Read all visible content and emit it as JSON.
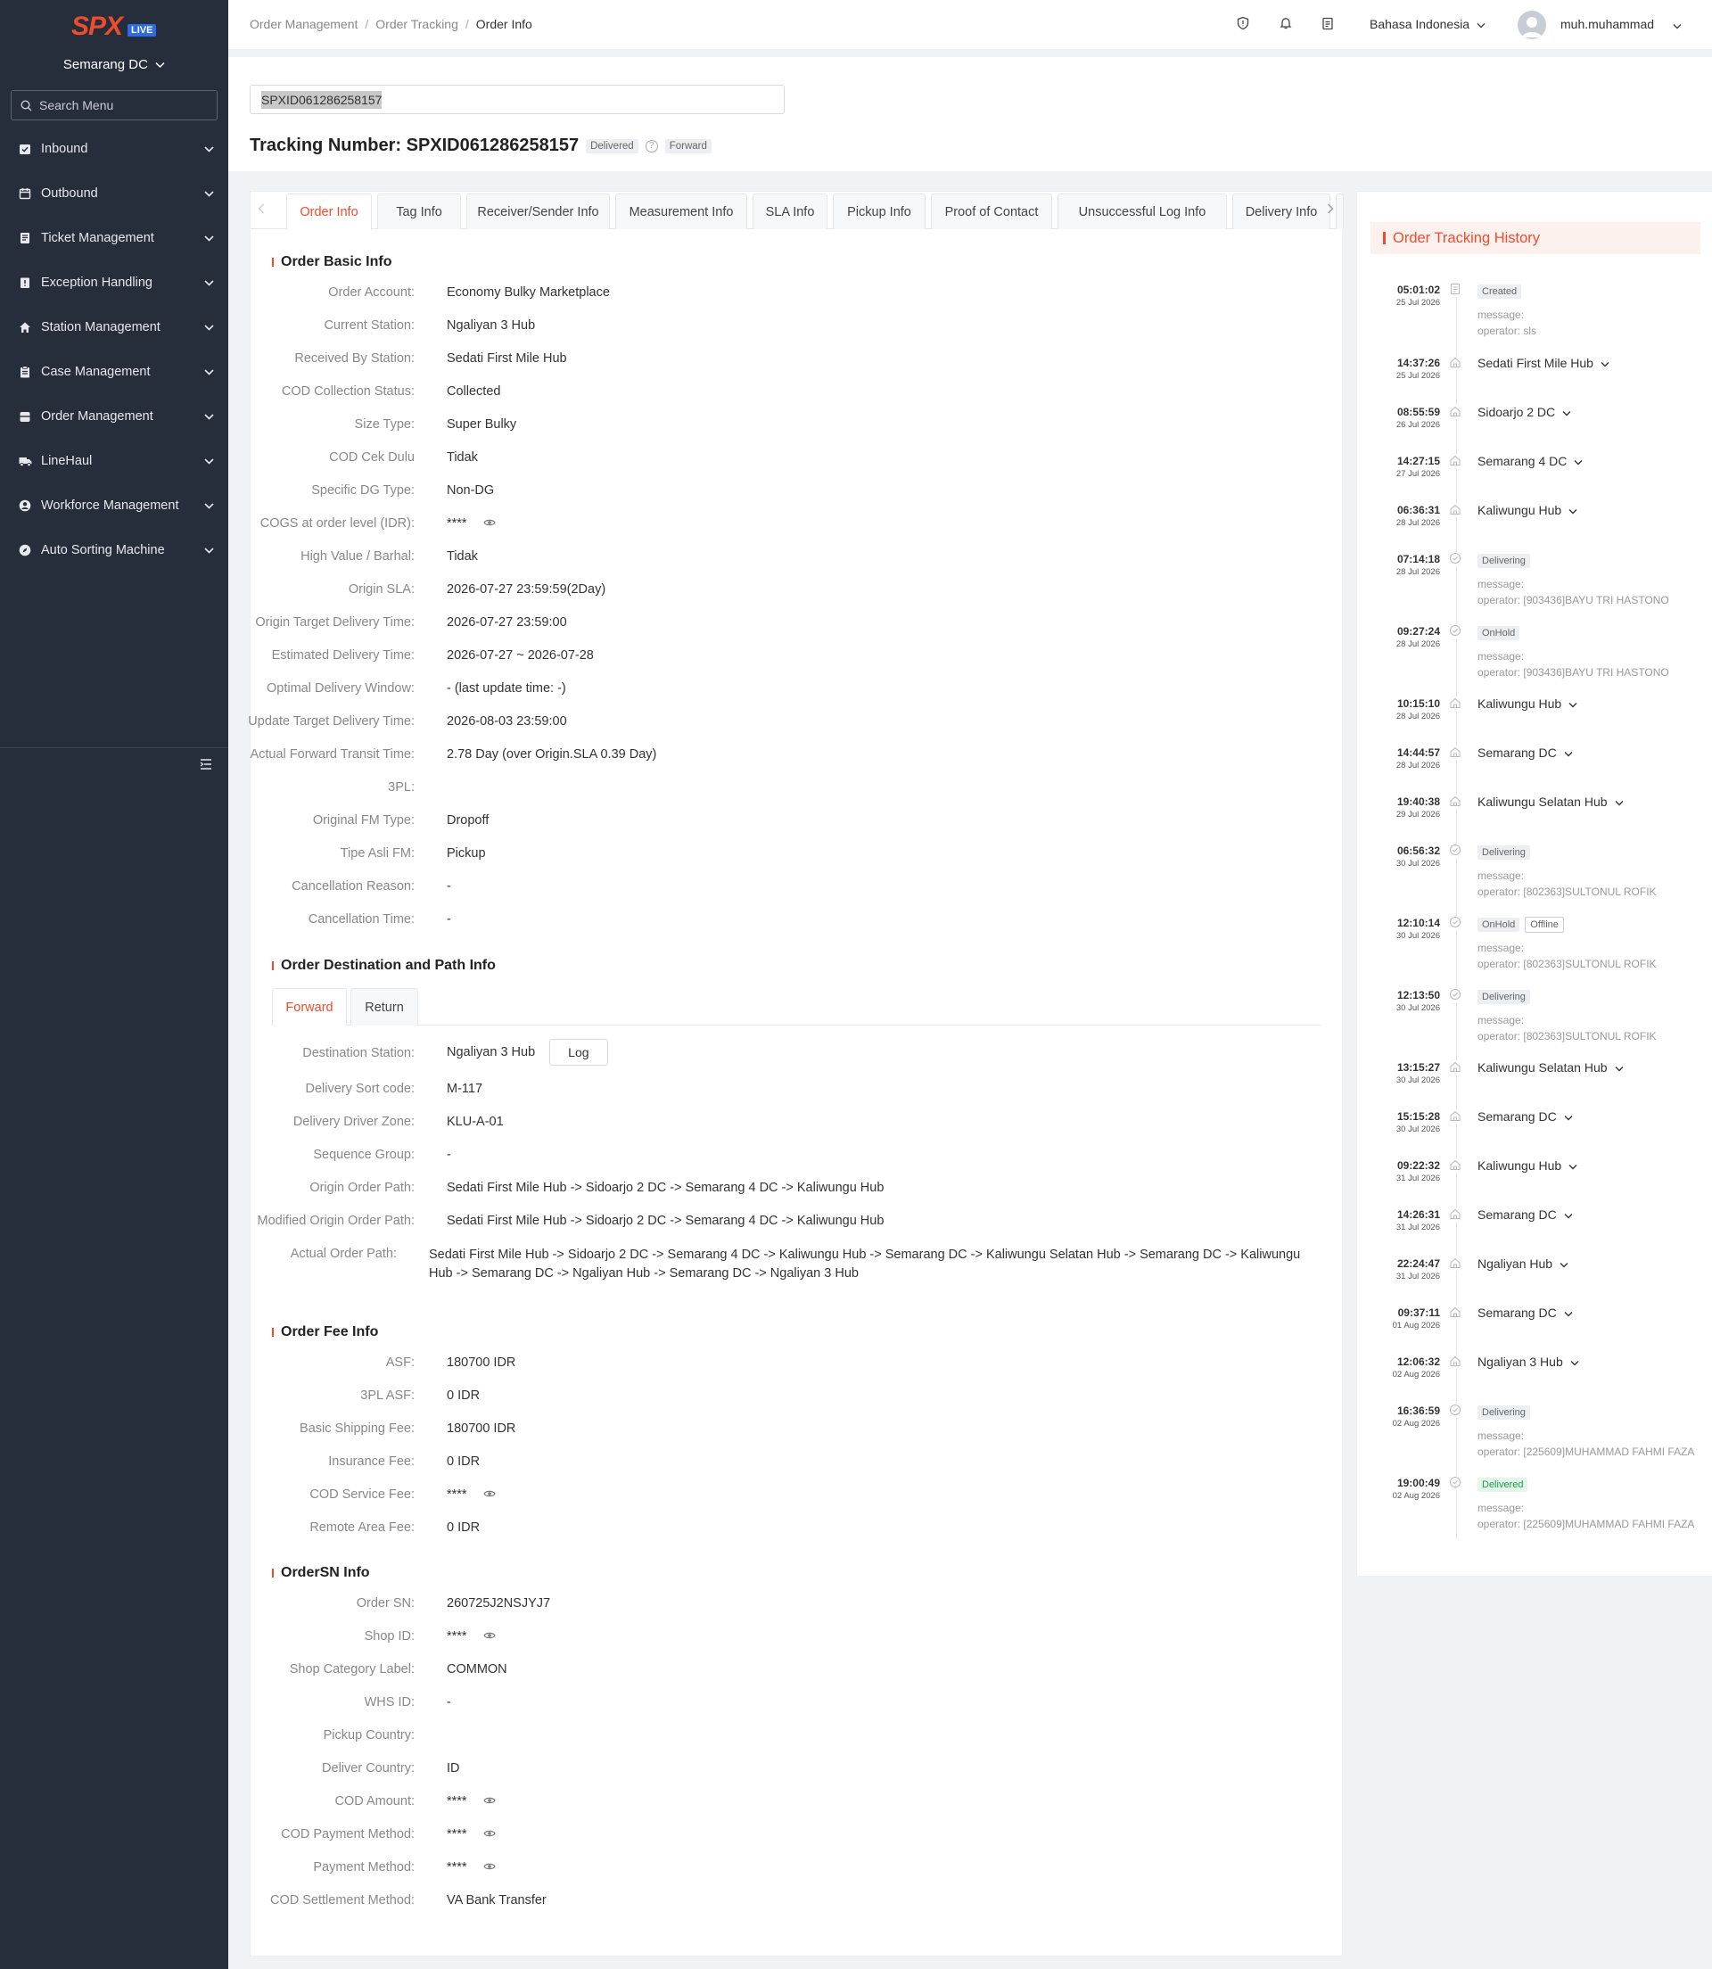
{
  "sidebar": {
    "logo_text": "SPX",
    "live_badge": "LIVE",
    "station": "Semarang DC",
    "search_placeholder": "Search Menu",
    "items": [
      {
        "label": "Inbound",
        "icon": "inbound-icon"
      },
      {
        "label": "Outbound",
        "icon": "outbound-icon"
      },
      {
        "label": "Ticket Management",
        "icon": "ticket-icon"
      },
      {
        "label": "Exception Handling",
        "icon": "exception-icon"
      },
      {
        "label": "Station Management",
        "icon": "home-icon"
      },
      {
        "label": "Case Management",
        "icon": "clipboard-icon"
      },
      {
        "label": "Order Management",
        "icon": "order-icon"
      },
      {
        "label": "LineHaul",
        "icon": "truck-icon"
      },
      {
        "label": "Workforce Management",
        "icon": "user-icon"
      },
      {
        "label": "Auto Sorting Machine",
        "icon": "compass-icon"
      }
    ]
  },
  "header": {
    "breadcrumb": [
      "Order Management",
      "Order Tracking",
      "Order Info"
    ],
    "language": "Bahasa Indonesia",
    "username": "muh.muhammad"
  },
  "top": {
    "search_value": "SPXID061286258157",
    "title_prefix": "Tracking Number: ",
    "tracking_number": "SPXID061286258157",
    "status_tag": "Delivered",
    "direction_tag": "Forward"
  },
  "tabs": [
    "Order Info",
    "Tag Info",
    "Receiver/Sender Info",
    "Measurement Info",
    "SLA Info",
    "Pickup Info",
    "Proof of Contact",
    "Unsuccessful Log Info",
    "Delivery Info"
  ],
  "basic_info": {
    "title": "Order Basic Info",
    "rows": [
      {
        "k": "Order Account:",
        "v": "Economy Bulky Marketplace"
      },
      {
        "k": "Current Station:",
        "v": "Ngaliyan 3 Hub"
      },
      {
        "k": "Received By Station:",
        "v": "Sedati First Mile Hub"
      },
      {
        "k": "COD Collection Status:",
        "v": "Collected"
      },
      {
        "k": "Size Type:",
        "v": "Super Bulky"
      },
      {
        "k": "COD Cek Dulu",
        "v": "Tidak"
      },
      {
        "k": "Specific DG Type:",
        "v": "Non-DG"
      },
      {
        "k": "COGS at order level (IDR):",
        "v": "****",
        "masked": true
      },
      {
        "k": "High Value / Barhal:",
        "v": "Tidak"
      },
      {
        "k": "Origin SLA:",
        "v": "2026-07-27 23:59:59(2Day)"
      },
      {
        "k": "Origin Target Delivery Time:",
        "v": "2026-07-27 23:59:00"
      },
      {
        "k": "Estimated Delivery Time:",
        "v": "2026-07-27 ~ 2026-07-28"
      },
      {
        "k": "Optimal Delivery Window:",
        "v": "- (last update time: -)"
      },
      {
        "k": "Update Target Delivery Time:",
        "v": "2026-08-03 23:59:00"
      },
      {
        "k": "Actual Forward Transit Time:",
        "v": "2.78 Day (over Origin.SLA 0.39 Day)"
      },
      {
        "k": "3PL:",
        "v": ""
      },
      {
        "k": "Original FM Type:",
        "v": "Dropoff"
      },
      {
        "k": "Tipe Asli FM:",
        "v": "Pickup"
      },
      {
        "k": "Cancellation Reason:",
        "v": "-"
      },
      {
        "k": "Cancellation Time:",
        "v": "-"
      }
    ]
  },
  "dest_info": {
    "title": "Order Destination and Path Info",
    "subtabs": [
      "Forward",
      "Return"
    ],
    "dest_label": "Destination Station:",
    "dest_value": "Ngaliyan 3 Hub",
    "log_button": "Log",
    "rows": [
      {
        "k": "Delivery Sort code:",
        "v": "M-117"
      },
      {
        "k": "Delivery Driver Zone:",
        "v": "KLU-A-01"
      },
      {
        "k": "Sequence Group:",
        "v": "-"
      },
      {
        "k": "Origin Order Path:",
        "v": "Sedati First Mile Hub  -> Sidoarjo 2 DC  -> Semarang 4 DC  -> Kaliwungu Hub"
      },
      {
        "k": "Modified Origin Order Path:",
        "v": "Sedati First Mile Hub  -> Sidoarjo 2 DC  -> Semarang 4 DC  -> Kaliwungu Hub"
      }
    ],
    "actual_path_label": "Actual Order Path:",
    "actual_path_value": "Sedati First Mile Hub  -> Sidoarjo 2 DC  -> Semarang 4 DC  -> Kaliwungu Hub  -> Semarang DC  -> Kaliwungu Selatan Hub  -> Semarang DC  -> Kaliwungu Hub  -> Semarang DC  -> Ngaliyan Hub  -> Semarang DC  -> Ngaliyan 3 Hub"
  },
  "fee_info": {
    "title": "Order Fee Info",
    "rows": [
      {
        "k": "ASF:",
        "v": "180700 IDR"
      },
      {
        "k": "3PL ASF:",
        "v": "0 IDR"
      },
      {
        "k": "Basic Shipping Fee:",
        "v": "180700 IDR"
      },
      {
        "k": "Insurance Fee:",
        "v": "0 IDR"
      },
      {
        "k": "COD Service Fee:",
        "v": "****",
        "masked": true
      },
      {
        "k": "Remote Area Fee:",
        "v": "0 IDR"
      }
    ]
  },
  "sn_info": {
    "title": "OrderSN Info",
    "rows": [
      {
        "k": "Order SN:",
        "v": "260725J2NSJYJ7"
      },
      {
        "k": "Shop ID:",
        "v": "****",
        "masked": true
      },
      {
        "k": "Shop Category Label:",
        "v": "COMMON"
      },
      {
        "k": "WHS ID:",
        "v": "-"
      },
      {
        "k": "Pickup Country:",
        "v": ""
      },
      {
        "k": "Deliver Country:",
        "v": "ID"
      },
      {
        "k": "COD Amount:",
        "v": "****",
        "masked": true
      },
      {
        "k": "COD Payment Method:",
        "v": "****",
        "masked": true
      },
      {
        "k": "Payment Method:",
        "v": "****",
        "masked": true
      },
      {
        "k": "COD Settlement Method:",
        "v": "VA Bank Transfer"
      }
    ]
  },
  "history": {
    "title": "Order Tracking History",
    "entries": [
      {
        "time": "05:01:02",
        "date": "25 Jul 2026",
        "type": "status",
        "tags": [
          "Created"
        ],
        "msg": [
          "message:",
          "operator: sls"
        ]
      },
      {
        "time": "14:37:26",
        "date": "25 Jul 2026",
        "type": "loc",
        "loc": "Sedati First Mile Hub"
      },
      {
        "time": "08:55:59",
        "date": "26 Jul 2026",
        "type": "loc",
        "loc": "Sidoarjo 2 DC"
      },
      {
        "time": "14:27:15",
        "date": "27 Jul 2026",
        "type": "loc",
        "loc": "Semarang 4 DC"
      },
      {
        "time": "06:36:31",
        "date": "28 Jul 2026",
        "type": "loc",
        "loc": "Kaliwungu Hub"
      },
      {
        "time": "07:14:18",
        "date": "28 Jul 2026",
        "type": "status",
        "tags": [
          "Delivering"
        ],
        "msg": [
          "message:",
          "operator: [903436]BAYU TRI HASTONO"
        ]
      },
      {
        "time": "09:27:24",
        "date": "28 Jul 2026",
        "type": "status",
        "tags": [
          "OnHold"
        ],
        "msg": [
          "message:",
          "operator: [903436]BAYU TRI HASTONO"
        ]
      },
      {
        "time": "10:15:10",
        "date": "28 Jul 2026",
        "type": "loc",
        "loc": "Kaliwungu Hub"
      },
      {
        "time": "14:44:57",
        "date": "28 Jul 2026",
        "type": "loc",
        "loc": "Semarang DC"
      },
      {
        "time": "19:40:38",
        "date": "29 Jul 2026",
        "type": "loc",
        "loc": "Kaliwungu Selatan Hub"
      },
      {
        "time": "06:56:32",
        "date": "30 Jul 2026",
        "type": "status",
        "tags": [
          "Delivering"
        ],
        "msg": [
          "message:",
          "operator: [802363]SULTONUL ROFIK"
        ]
      },
      {
        "time": "12:10:14",
        "date": "30 Jul 2026",
        "type": "status",
        "tags": [
          "OnHold",
          "Offline"
        ],
        "msg": [
          "message:",
          "operator: [802363]SULTONUL ROFIK"
        ]
      },
      {
        "time": "12:13:50",
        "date": "30 Jul 2026",
        "type": "status",
        "tags": [
          "Delivering"
        ],
        "msg": [
          "message:",
          "operator: [802363]SULTONUL ROFIK"
        ]
      },
      {
        "time": "13:15:27",
        "date": "30 Jul 2026",
        "type": "loc",
        "loc": "Kaliwungu Selatan Hub"
      },
      {
        "time": "15:15:28",
        "date": "30 Jul 2026",
        "type": "loc",
        "loc": "Semarang DC"
      },
      {
        "time": "09:22:32",
        "date": "31 Jul 2026",
        "type": "loc",
        "loc": "Kaliwungu Hub"
      },
      {
        "time": "14:26:31",
        "date": "31 Jul 2026",
        "type": "loc",
        "loc": "Semarang DC"
      },
      {
        "time": "22:24:47",
        "date": "31 Jul 2026",
        "type": "loc",
        "loc": "Ngaliyan Hub"
      },
      {
        "time": "09:37:11",
        "date": "01 Aug 2026",
        "type": "loc",
        "loc": "Semarang DC"
      },
      {
        "time": "12:06:32",
        "date": "02 Aug 2026",
        "type": "loc",
        "loc": "Ngaliyan 3 Hub"
      },
      {
        "time": "16:36:59",
        "date": "02 Aug 2026",
        "type": "status",
        "tags": [
          "Delivering"
        ],
        "msg": [
          "message:",
          "operator: [225609]MUHAMMAD FAHMI FAZA"
        ]
      },
      {
        "time": "19:00:49",
        "date": "02 Aug 2026",
        "type": "status",
        "tags": [
          "Delivered"
        ],
        "msg": [
          "message:",
          "operator: [225609]MUHAMMAD FAHMI FAZA"
        ]
      }
    ]
  },
  "colors": {
    "accent": "#ee4d2d",
    "sidebar_bg": "#262d3b",
    "live_badge": "#2d6be6",
    "delivered_green": "#1d9a47"
  }
}
